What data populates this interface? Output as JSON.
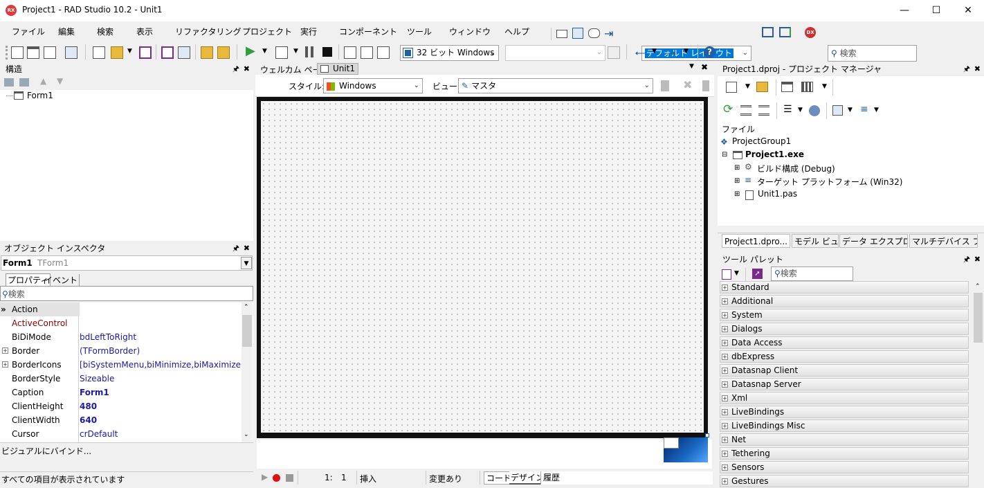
{
  "window": {
    "title": "Project1 - RAD Studio 10.2 - Unit1",
    "icon_text": "RX"
  },
  "menu": [
    "ファイル",
    "編集",
    "検索",
    "表示",
    "リファクタリング",
    "プロジェクト",
    "実行",
    "コンポーネント",
    "ツール",
    "ウィンドウ",
    "ヘルプ"
  ],
  "toolbar": {
    "layout_select": "デフォルト レイアウト",
    "search_placeholder": "検索",
    "platform_select": "32 ビット Windows",
    "config_select": ""
  },
  "structure": {
    "title": "構造",
    "tree_root": "Form1"
  },
  "inspector": {
    "title": "オブジェクト インスペクタ",
    "selected_name": "Form1",
    "selected_type": "TForm1",
    "tabs": [
      "プロパティ",
      "イベント"
    ],
    "search_placeholder": "検索",
    "rows": [
      {
        "name": "Action",
        "value": ""
      },
      {
        "name": "ActiveControl",
        "value": ""
      },
      {
        "name": "BiDiMode",
        "value": "bdLeftToRight"
      },
      {
        "name": "Border",
        "value": "(TFormBorder)"
      },
      {
        "name": "BorderIcons",
        "value": "[biSystemMenu,biMinimize,biMaximize]"
      },
      {
        "name": "BorderStyle",
        "value": "Sizeable"
      },
      {
        "name": "Caption",
        "value": "Form1"
      },
      {
        "name": "ClientHeight",
        "value": "480"
      },
      {
        "name": "ClientWidth",
        "value": "640"
      },
      {
        "name": "Cursor",
        "value": "crDefault"
      }
    ],
    "bind_link": "ビジュアルにバインド...",
    "status": "すべての項目が表示されています"
  },
  "editor": {
    "tabs": [
      "ウェルカム ページ",
      "Unit1"
    ],
    "style_label": "スタイル:",
    "style_value": "Windows",
    "view_label": "ビュー:",
    "view_value": "マスタ",
    "status": {
      "line": "1:",
      "col": "1",
      "mode": "挿入",
      "modified": "変更あり"
    },
    "bottom_tabs": [
      "コード",
      "デザイン",
      "履歴"
    ]
  },
  "project_manager": {
    "title": "Project1.dproj - プロジェクト マネージャ",
    "section": "ファイル",
    "tree": [
      "ProjectGroup1",
      "Project1.exe",
      "ビルド構成 (Debug)",
      "ターゲット プラットフォーム (Win32)",
      "Unit1.pas"
    ],
    "tabs": [
      "Project1.dpro...",
      "モデル ビュー",
      "データ エクスプロ...",
      "マルチデバイス プ..."
    ]
  },
  "palette": {
    "title": "ツール パレット",
    "search_placeholder": "検索",
    "categories": [
      "Standard",
      "Additional",
      "System",
      "Dialogs",
      "Data Access",
      "dbExpress",
      "Datasnap Client",
      "Datasnap Server",
      "Xml",
      "LiveBindings",
      "LiveBindings Misc",
      "Net",
      "Tethering",
      "Sensors",
      "Gestures"
    ]
  },
  "colors": {
    "accent": "#0078d7",
    "inspector_name": "#8b0000",
    "inspector_value": "#1a1aa6"
  }
}
